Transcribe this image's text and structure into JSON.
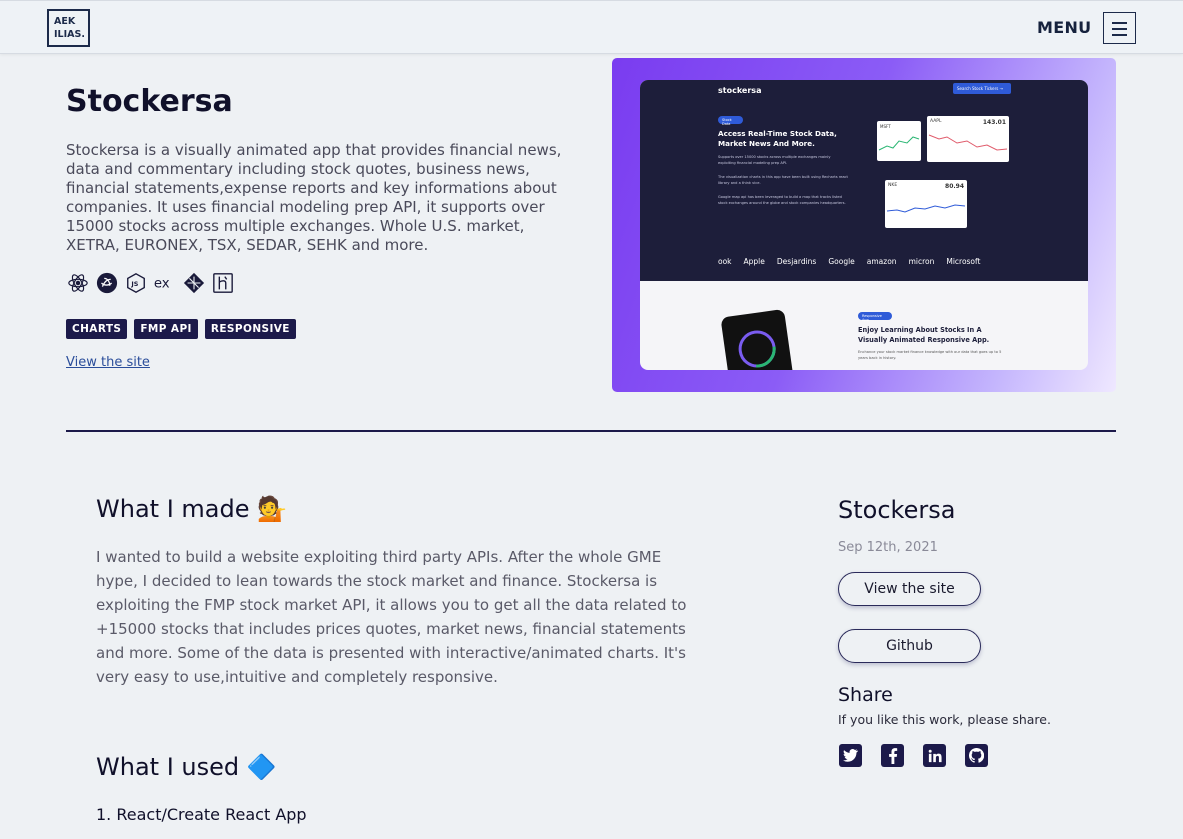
{
  "header": {
    "logo_line1": "AEK",
    "logo_line2": "ILIAS.",
    "menu_label": "MENU"
  },
  "project": {
    "title": "Stockersa",
    "description": "Stockersa is a visually animated app that provides financial news, data and commentary including stock quotes, business news, financial statements,expense reports and key informations about companies. It uses financial modeling prep API, it supports over 15000 stocks across multiple exchanges. Whole U.S. market, XETRA, EURONEX, TSX, SEDAR, SEHK and more.",
    "tech_icons": [
      "react-icon",
      "redux-icon",
      "nodejs-icon",
      "express-icon",
      "netlify-icon",
      "heroku-icon"
    ],
    "tags": [
      "CHARTS",
      "FMP API",
      "RESPONSIVE"
    ],
    "view_link": "View the site"
  },
  "preview": {
    "brand": "stockersa",
    "search": "Search Stock Tickers →",
    "pill": "Stock Data",
    "headline": "Access Real-Time Stock Data, Market News And More.",
    "text1": "Supports over 15000 stocks across multiple exchanges mainly exploiting financial modeling prep API.",
    "text2": "The visualization charts in this app have been built using Recharts react library and a think vice.",
    "text3": "Google map api has been leveraged to build a map that tracks listed stock exchanges around the globe and stock companies headquarters.",
    "logos": [
      "ook",
      "Apple",
      "Desjardins",
      "Google",
      "amazon",
      "micron",
      "Microsoft"
    ],
    "pill2": "Responsive App",
    "headline2": "Enjoy Learning About Stocks In A Visually Animated Responsive App.",
    "text4": "Enchance your stock market finance knowledge with our data that goes up to 5 years back in history.",
    "card_msft": "MSFT",
    "card_aapl": "AAPL",
    "card_aapl_val": "143.01",
    "card_nke": "NKE",
    "card_nke_val": "80.94"
  },
  "details": {
    "made_heading": "What I made 💁",
    "made_body": "I wanted to build a website exploiting third party APIs. After the whole GME hype, I decided to lean towards the stock market and finance. Stockersa is exploiting the FMP stock market API, it allows you to get all the data related to +15000 stocks that includes prices quotes, market news, financial statements and more. Some of the data is presented with interactive/animated charts. It's very easy to use,intuitive and completely responsive.",
    "used_heading": "What I used 🔷",
    "used_item1": "1. React/Create React App"
  },
  "sidebar": {
    "title": "Stockersa",
    "date": "Sep 12th, 2021",
    "site_button": "View the site",
    "github_button": "Github",
    "share_heading": "Share",
    "share_text": "If you like this work, please share.",
    "social": [
      "twitter-icon",
      "facebook-icon",
      "linkedin-icon",
      "github-icon"
    ]
  }
}
